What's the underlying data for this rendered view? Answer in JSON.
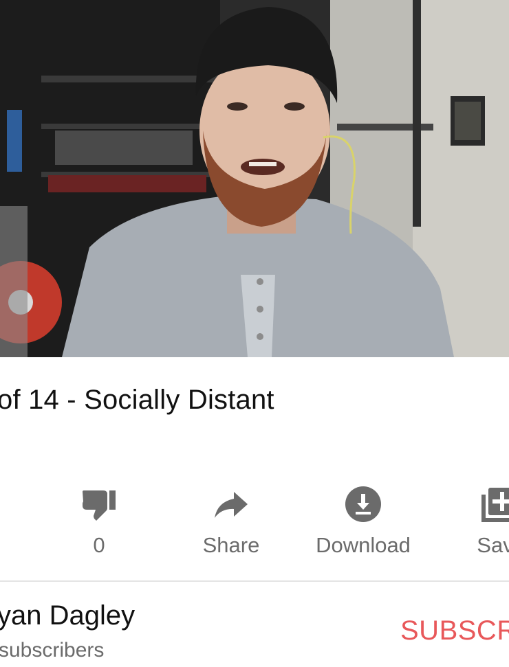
{
  "video": {
    "thumbnail_icon": "person-talking-video-frame"
  },
  "title": "of 14 - Socially Distant",
  "actions": [
    {
      "icon": "dislike-icon",
      "label": "0"
    },
    {
      "icon": "share-icon",
      "label": "Share"
    },
    {
      "icon": "download-icon",
      "label": "Download"
    },
    {
      "icon": "save-to-playlist-icon",
      "label": "Sav"
    }
  ],
  "channel": {
    "name": "yan Dagley",
    "subscribers": "subscribers",
    "subscribe_label": "SUBSCR"
  },
  "colors": {
    "icon_gray": "#6b6b6b",
    "text_dark": "#111111",
    "subscribe_red": "#e8585a",
    "divider": "#e4e4e4"
  }
}
